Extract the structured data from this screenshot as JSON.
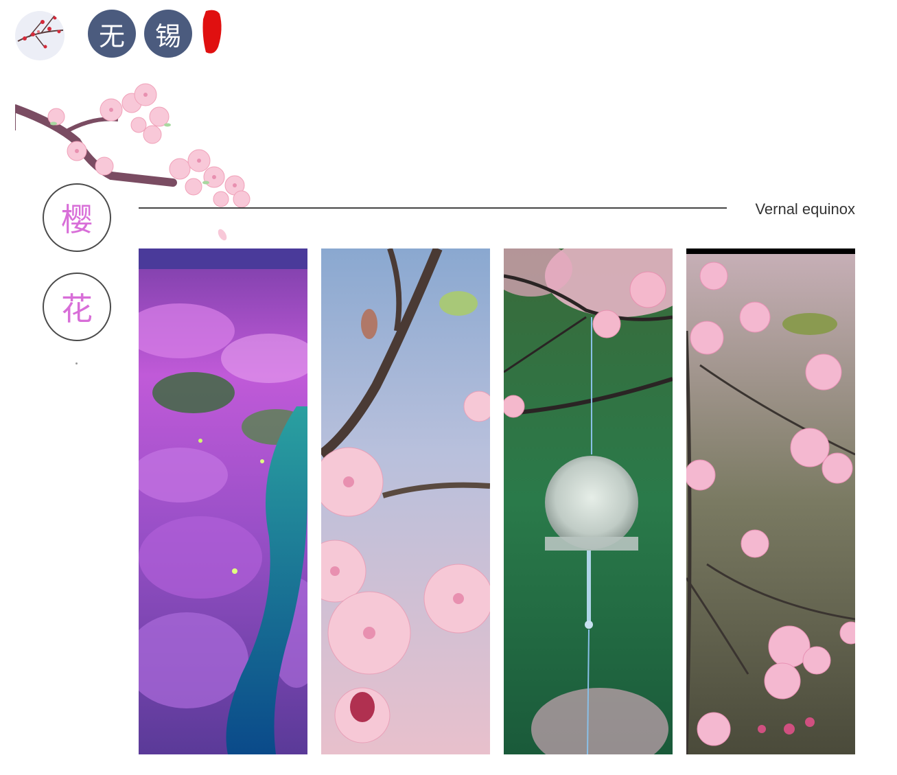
{
  "header": {
    "logo_char_1": "无",
    "logo_char_2": "锡"
  },
  "section": {
    "title_char_1": "樱",
    "title_char_2": "花",
    "subtitle": "Vernal equinox"
  },
  "colors": {
    "logo_circle": "#4b5b7e",
    "title_text": "#d86ed8",
    "seal_red": "#e01010",
    "rule": "#444444"
  },
  "gallery": {
    "images": [
      {
        "icon": "sakura-river-night-photo"
      },
      {
        "icon": "cherry-blossom-branch-photo"
      },
      {
        "icon": "glass-wind-chime-photo"
      },
      {
        "icon": "pink-blossom-twigs-photo"
      }
    ]
  }
}
